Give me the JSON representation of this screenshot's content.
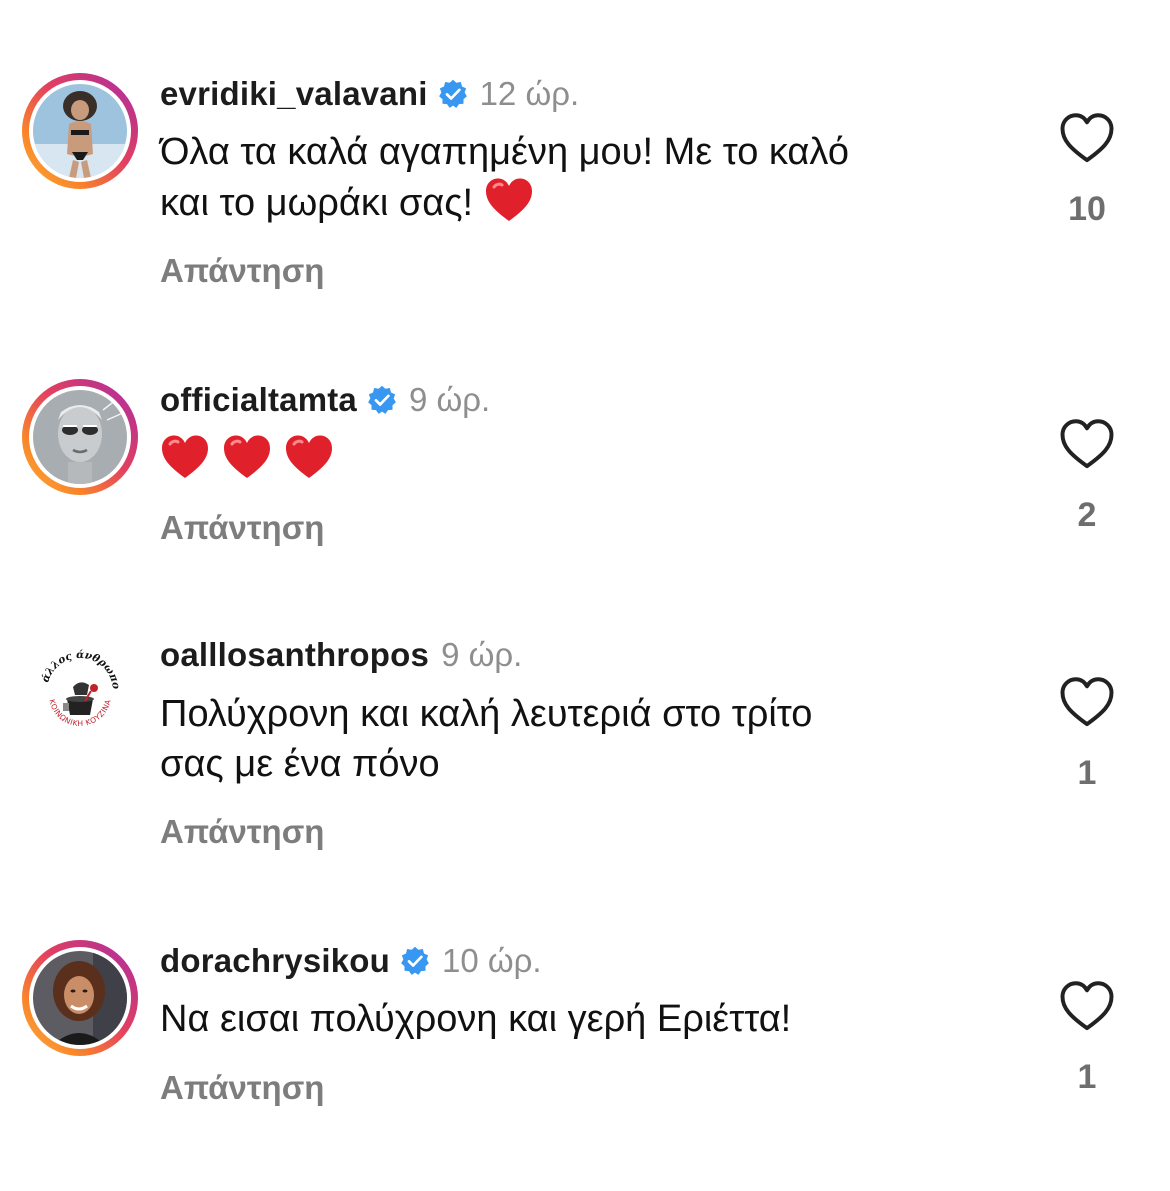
{
  "comments": [
    {
      "username": "evridiki_valavani",
      "verified": true,
      "time": "12 ώρ.",
      "text_line1": "Όλα τα καλά αγαπημένη μου! Με το καλό",
      "text_line2": "και το μωράκι σας!",
      "emoji_count": 1,
      "reply_label": "Απάντηση",
      "likes": "10",
      "story_ring": true
    },
    {
      "username": "officialtamta",
      "verified": true,
      "time": "9 ώρ.",
      "text_line1": "",
      "text_line2": "",
      "emoji_count": 3,
      "reply_label": "Απάντηση",
      "likes": "2",
      "story_ring": true
    },
    {
      "username": "oalllosanthropos",
      "verified": false,
      "time": "9 ώρ.",
      "text_line1": "Πολύχρονη και καλή λευτεριά στο τρίτο",
      "text_line2": "σας με ένα πόνο",
      "emoji_count": 0,
      "reply_label": "Απάντηση",
      "likes": "1",
      "story_ring": false,
      "avatar_logo_text_top": "Ο άλλος άνθρωπος",
      "avatar_logo_text_bottom": "ΚΟΙΝΩΝΙΚΗ ΚΟΥΖΙΝΑ"
    },
    {
      "username": "dorachrysikou",
      "verified": true,
      "time": "10 ώρ.",
      "text_line1": "Να εισαι πολύχρονη και γερή Εριέττα!",
      "text_line2": "",
      "emoji_count": 0,
      "reply_label": "Απάντηση",
      "likes": "1",
      "story_ring": true
    }
  ],
  "colors": {
    "verified_blue": "#3897f0",
    "heart_red": "#e0212b",
    "muted_gray": "#8e8e8e"
  },
  "icons": {
    "like": "heart-outline-icon",
    "verified": "verified-badge-icon",
    "emoji": "red-heart-emoji"
  }
}
